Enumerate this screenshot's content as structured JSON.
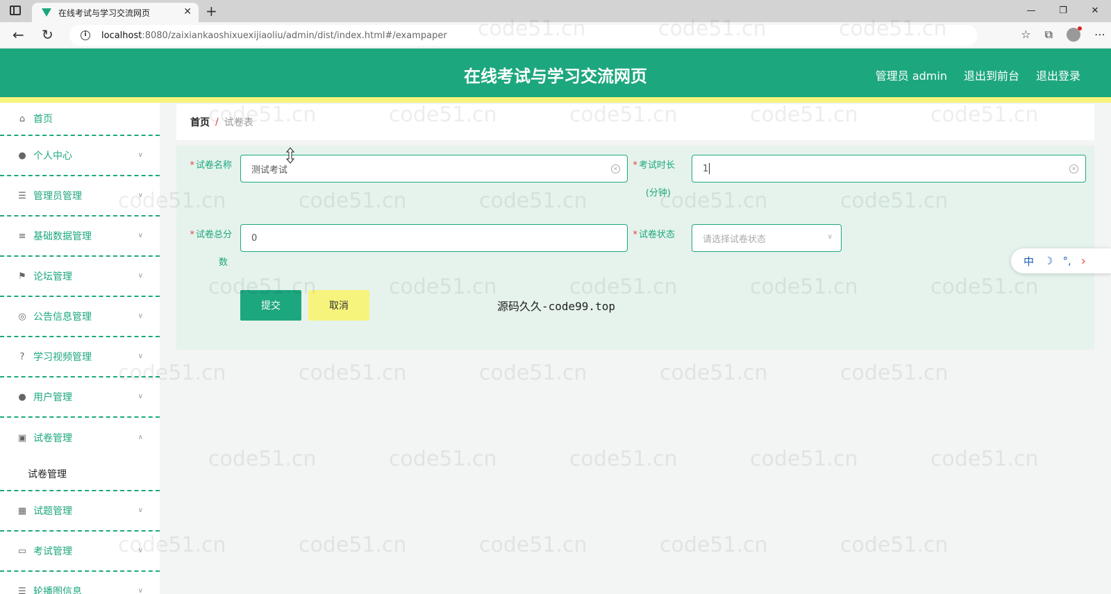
{
  "browser": {
    "tab_title": "在线考试与学习交流网页",
    "url_host": "localhost",
    "url_path": ":8080/zaixiankaoshixuexijiaoliu/admin/dist/index.html#/exampaper"
  },
  "header": {
    "title": "在线考试与学习交流网页",
    "user": "管理员 admin",
    "to_front": "退出到前台",
    "logout": "退出登录"
  },
  "sidebar": {
    "items": [
      {
        "label": "首页"
      },
      {
        "label": "个人中心"
      },
      {
        "label": "管理员管理"
      },
      {
        "label": "基础数据管理"
      },
      {
        "label": "论坛管理"
      },
      {
        "label": "公告信息管理"
      },
      {
        "label": "学习视频管理"
      },
      {
        "label": "用户管理"
      },
      {
        "label": "试卷管理"
      },
      {
        "label": "试题管理"
      },
      {
        "label": "考试管理"
      },
      {
        "label": "轮播图信息"
      }
    ],
    "submenu_label": "试卷管理"
  },
  "breadcrumb": {
    "home": "首页",
    "separator": "/",
    "current": "试卷表"
  },
  "form": {
    "name_label_line1": "试卷名称",
    "name_value": "测试考试",
    "duration_label_line1": "考试时长",
    "duration_label_line2": "(分钟)",
    "duration_value": "1",
    "score_label_line1": "试卷总分",
    "score_label_line2": "数",
    "score_value": "0",
    "status_label_line1": "试卷状态",
    "status_placeholder": "请选择试卷状态",
    "required_mark": "*",
    "submit_label": "提交",
    "cancel_label": "取消"
  },
  "source_note": "源码久久-code99.top",
  "ime": {
    "lang": "中",
    "moon": "☽",
    "punct": "°,",
    "arrow": "›"
  },
  "watermark": "code51.cn",
  "colors": {
    "primary": "#1da77e",
    "accent_yellow": "#f6f47c",
    "required_red": "#e0433b",
    "form_bg": "#e5f3ec"
  }
}
